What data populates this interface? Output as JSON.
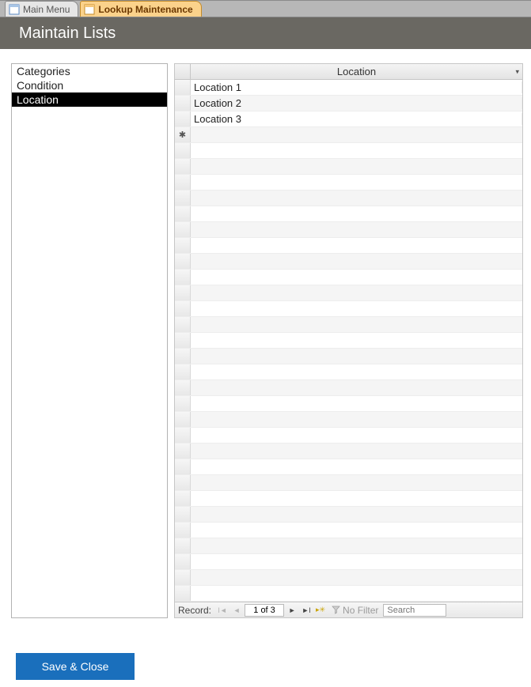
{
  "tabs": [
    {
      "label": "Main Menu",
      "active": false
    },
    {
      "label": "Lookup Maintenance",
      "active": true
    }
  ],
  "header": {
    "title": "Maintain Lists"
  },
  "listbox": {
    "items": [
      "Categories",
      "Condition",
      "Location"
    ],
    "selected_index": 2
  },
  "grid": {
    "column_header": "Location",
    "rows": [
      "Location 1",
      "Location 2",
      "Location 3"
    ],
    "new_row_marker": "✱"
  },
  "record_nav": {
    "label": "Record:",
    "position_text": "1 of 3",
    "no_filter_label": "No Filter",
    "search_placeholder": "Search"
  },
  "buttons": {
    "save_close": "Save & Close"
  }
}
